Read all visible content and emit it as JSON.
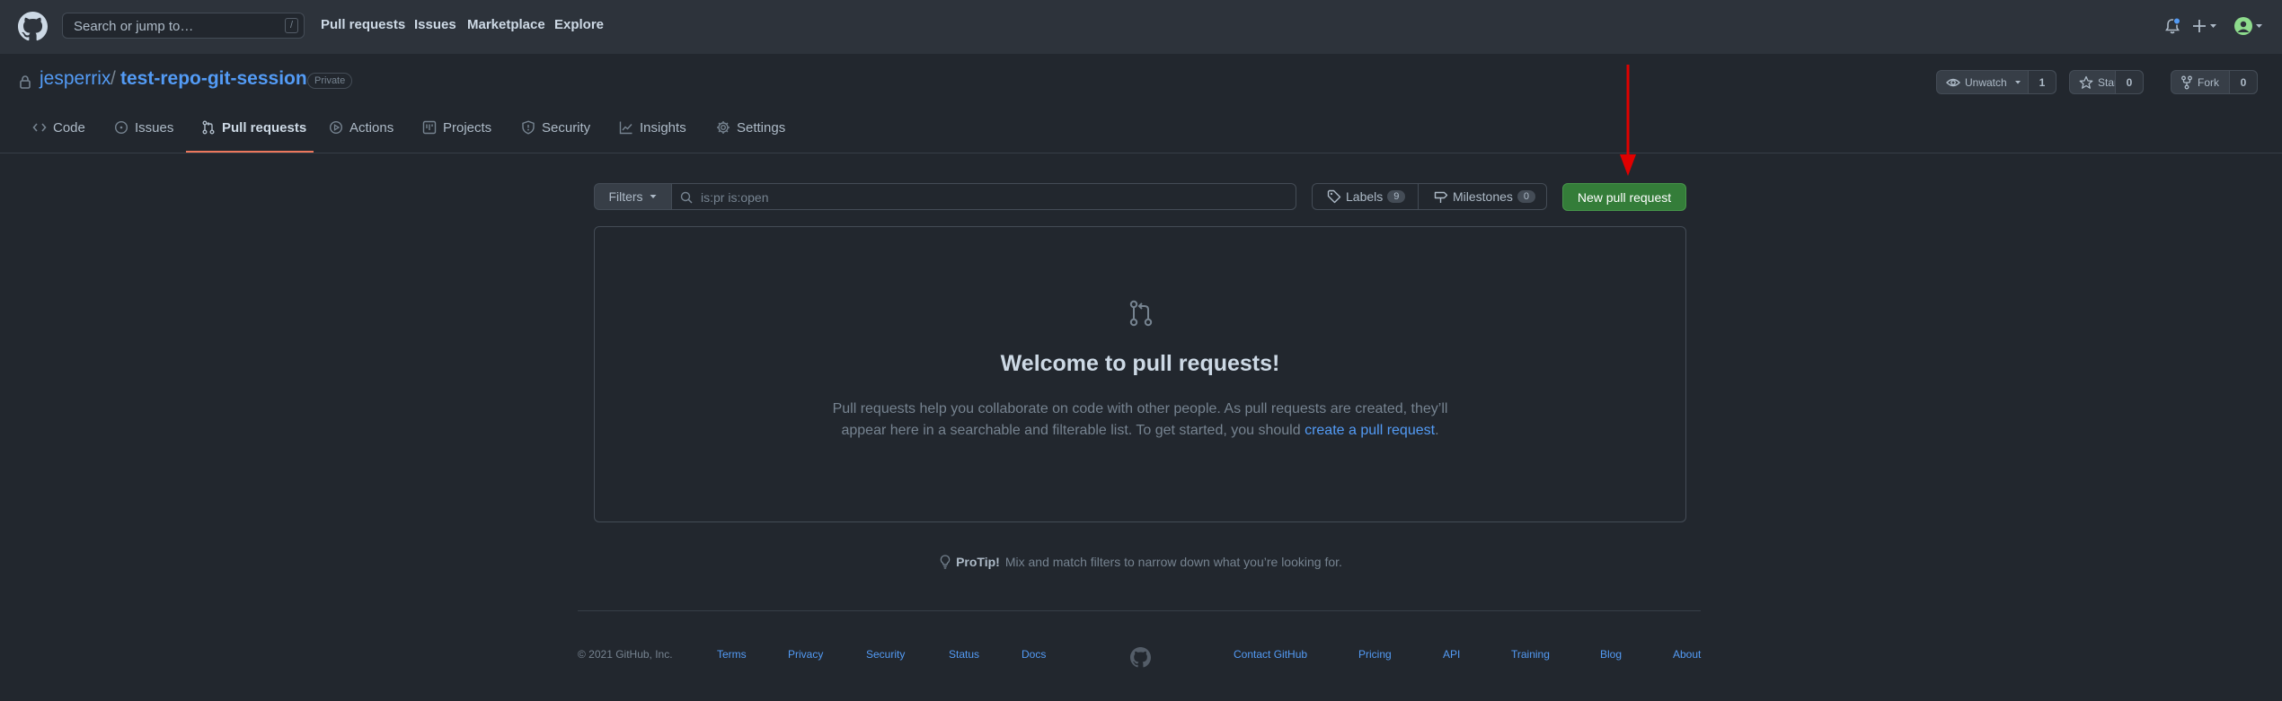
{
  "header": {
    "search_placeholder": "Search or jump to…",
    "search_shortcut": "/",
    "nav": [
      "Pull requests",
      "Issues",
      "Marketplace",
      "Explore"
    ]
  },
  "repo": {
    "owner": "jesperrix",
    "separator": "/",
    "name": "test-repo-git-session",
    "visibility": "Private",
    "watch_label": "Unwatch",
    "watch_count": "1",
    "star_label": "Star",
    "star_count": "0",
    "fork_label": "Fork",
    "fork_count": "0"
  },
  "tabs": [
    {
      "label": "Code",
      "icon": "code-icon"
    },
    {
      "label": "Issues",
      "icon": "issue-icon"
    },
    {
      "label": "Pull requests",
      "icon": "pull-request-icon",
      "selected": true
    },
    {
      "label": "Actions",
      "icon": "play-icon"
    },
    {
      "label": "Projects",
      "icon": "project-icon"
    },
    {
      "label": "Security",
      "icon": "shield-icon"
    },
    {
      "label": "Insights",
      "icon": "graph-icon"
    },
    {
      "label": "Settings",
      "icon": "gear-icon"
    }
  ],
  "filterbar": {
    "filters_label": "Filters",
    "query": "is:pr is:open",
    "labels_label": "Labels",
    "labels_count": "9",
    "milestones_label": "Milestones",
    "milestones_count": "0",
    "new_pr_label": "New pull request"
  },
  "blankslate": {
    "title": "Welcome to pull requests!",
    "line1": "Pull requests help you collaborate on code with other people. As pull requests are created, they’ll",
    "line2_before": "appear here in a searchable and filterable list. To get started, you should ",
    "link": "create a pull request",
    "line2_after": "."
  },
  "protip": {
    "label": "ProTip!",
    "text": "Mix and match filters to narrow down what you’re looking for."
  },
  "footer": {
    "copyright": "© 2021 GitHub, Inc.",
    "left_links": [
      "Terms",
      "Privacy",
      "Security",
      "Status",
      "Docs"
    ],
    "right_links": [
      "Contact GitHub",
      "Pricing",
      "API",
      "Training",
      "Blog",
      "About"
    ]
  },
  "colors": {
    "accent_link": "#539bf5",
    "primary_button": "#347d39",
    "selected_tab_underline": "#ec775c",
    "annotation_arrow": "#e00000",
    "notification_dot": "#539bf5"
  }
}
